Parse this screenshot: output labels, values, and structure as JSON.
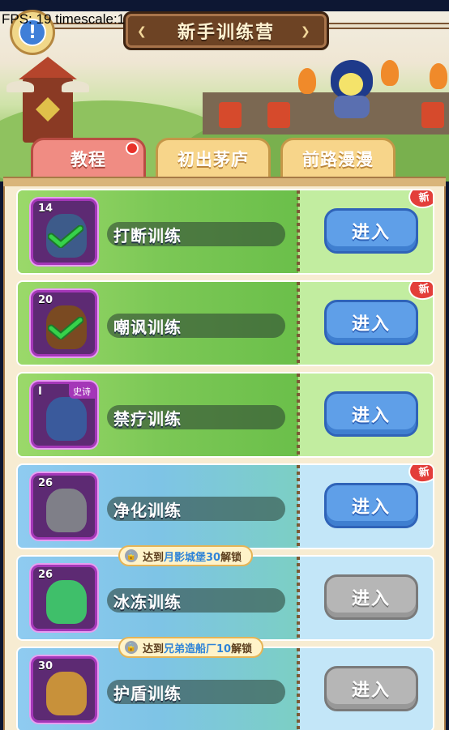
{
  "header": {
    "title": "新手训练营",
    "fps_text": "FPS: 19 timescale:1",
    "alert_glyph": "!"
  },
  "tabs": [
    {
      "label": "教程",
      "active": true,
      "has_dot": true
    },
    {
      "label": "初出茅庐",
      "active": false
    },
    {
      "label": "前路漫漫",
      "active": false
    }
  ],
  "items": [
    {
      "name": "打断训练",
      "level": "14",
      "theme": "green",
      "button": "进入",
      "enabled": true,
      "new": true,
      "new_label": "新",
      "completed": true,
      "icon": "armor-icon",
      "icon_color": "#3d5b8a"
    },
    {
      "name": "嘲讽训练",
      "level": "20",
      "theme": "green",
      "button": "进入",
      "enabled": true,
      "new": true,
      "new_label": "新",
      "completed": true,
      "icon": "gauntlet-icon",
      "icon_color": "#7a4a22"
    },
    {
      "name": "禁疗训练",
      "level": "I",
      "tag": "史诗",
      "theme": "green",
      "button": "进入",
      "enabled": true,
      "new": false,
      "completed": false,
      "icon": "hero-portrait-icon",
      "icon_color": "#3a5a9c"
    },
    {
      "name": "净化训练",
      "level": "26",
      "theme": "blue",
      "button": "进入",
      "enabled": true,
      "new": true,
      "new_label": "新",
      "completed": false,
      "icon": "boots-icon",
      "icon_color": "#7f7f88"
    },
    {
      "name": "冰冻训练",
      "level": "26",
      "theme": "blue",
      "button": "进入",
      "enabled": false,
      "new": false,
      "completed": false,
      "icon": "helmet-icon",
      "icon_color": "#3fbf6a",
      "lock": {
        "prefix": "达到",
        "highlight": "月影城堡30",
        "suffix": "解锁"
      }
    },
    {
      "name": "护盾训练",
      "level": "30",
      "theme": "blue",
      "button": "进入",
      "enabled": false,
      "new": false,
      "completed": false,
      "icon": "ring-icon",
      "icon_color": "#c8913a",
      "lock": {
        "prefix": "达到",
        "highlight": "兄弟造船厂10",
        "suffix": "解锁"
      }
    }
  ],
  "colors": {
    "accent_blue": "#5f9fe8",
    "disabled_gray": "#b6b6b6",
    "tab_active": "#f08c83",
    "tab_inactive": "#f7d58a"
  }
}
